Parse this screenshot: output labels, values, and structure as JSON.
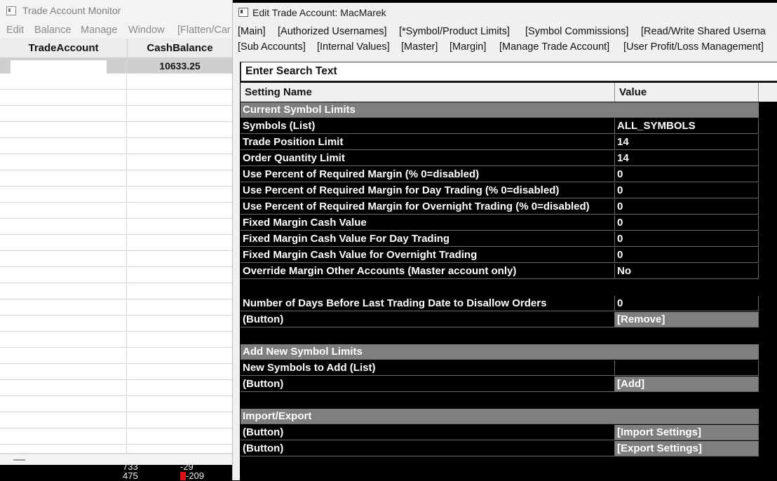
{
  "left_window": {
    "title": "Trade Account Monitor",
    "menu": [
      "Edit",
      "Balance",
      "Manage",
      "Window",
      "[Flatten/Car"
    ],
    "columns": [
      "TradeAccount",
      "CashBalance"
    ],
    "rows": [
      {
        "account": "",
        "cash_balance": "10633.25"
      }
    ],
    "underlying_values": [
      "733",
      "475",
      "-29",
      "-209"
    ]
  },
  "right_window": {
    "title": "Edit Trade Account: MacMarek",
    "tabs_row1": [
      "[Main]",
      "[Authorized Usernames]",
      "[*Symbol/Product Limits]",
      "[Symbol Commissions]",
      "[Read/Write Shared Userna"
    ],
    "tabs_row2": [
      "[Sub Accounts]",
      "[Internal Values]",
      "[Master]",
      "[Margin]",
      "[Manage Trade Account]",
      "[User Profit/Loss Management]"
    ],
    "search_placeholder": "Enter Search Text",
    "columns": {
      "name": "Setting Name",
      "value": "Value"
    },
    "section1": "Current Symbol Limits",
    "settings": [
      {
        "name": "Symbols (List)",
        "value": "ALL_SYMBOLS"
      },
      {
        "name": "Trade Position Limit",
        "value": "14"
      },
      {
        "name": "Order Quantity Limit",
        "value": "14"
      },
      {
        "name": "Use Percent of Required Margin (% 0=disabled)",
        "value": "0"
      },
      {
        "name": "Use Percent of Required Margin for Day Trading (% 0=disabled)",
        "value": "0"
      },
      {
        "name": "Use Percent of Required Margin for Overnight Trading (% 0=disabled)",
        "value": "0"
      },
      {
        "name": "Fixed Margin Cash Value",
        "value": "0"
      },
      {
        "name": "Fixed Margin Cash Value For Day Trading",
        "value": "0"
      },
      {
        "name": "Fixed Margin Cash Value for Overnight Trading",
        "value": "0"
      },
      {
        "name": "Override Margin Other Accounts (Master account only)",
        "value": "No"
      }
    ],
    "days_before": {
      "name": "Number of Days Before Last Trading Date to Disallow Orders",
      "value": "0"
    },
    "remove_row": {
      "name": " (Button)",
      "value": "[Remove]"
    },
    "section2": "Add New Symbol Limits",
    "new_symbols": {
      "name": "New Symbols to Add (List)",
      "value": ""
    },
    "add_row": {
      "name": " (Button)",
      "value": "[Add]"
    },
    "section3": "Import/Export",
    "import_row": {
      "name": " (Button)",
      "value": "[Import Settings]"
    },
    "export_row": {
      "name": " (Button)",
      "value": "[Export Settings]"
    }
  }
}
